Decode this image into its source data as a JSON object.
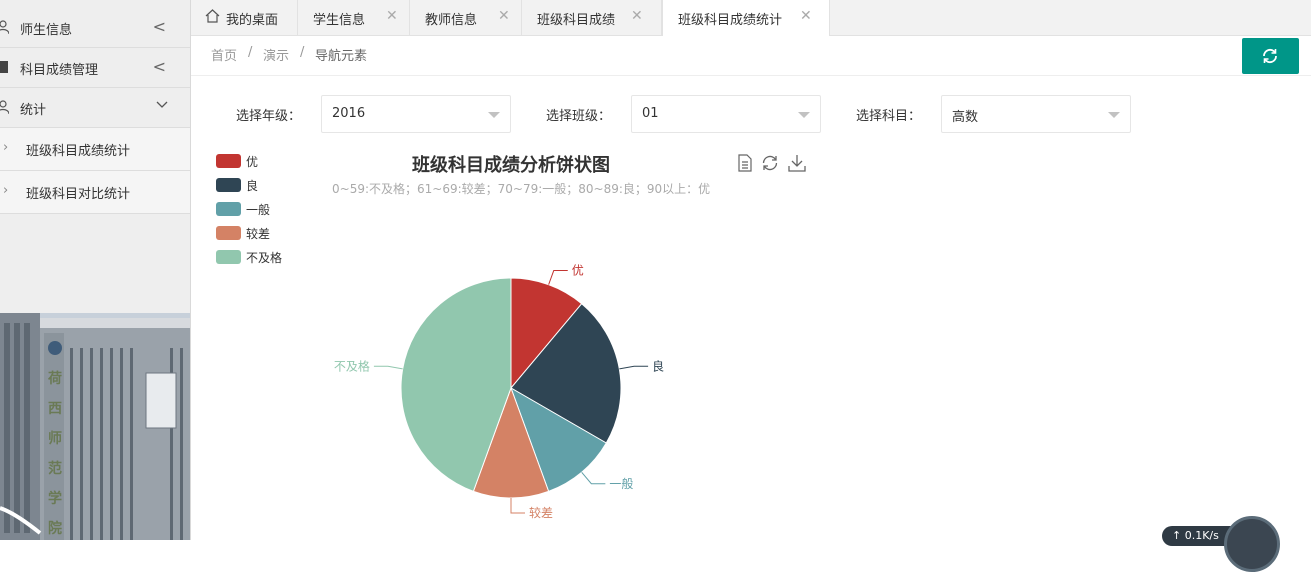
{
  "sidebar": {
    "items": [
      {
        "label": "师生信息",
        "arrow": "<"
      },
      {
        "label": "科目成绩管理",
        "arrow": "<"
      },
      {
        "label": "统计",
        "arrow": "v"
      }
    ],
    "subitems": [
      {
        "label": "班级科目成绩统计"
      },
      {
        "label": "班级科目对比统计"
      }
    ],
    "campus_sign": "荷 西 师 范 学 院"
  },
  "tabs": [
    {
      "label": "我的桌面",
      "icon": "home-icon"
    },
    {
      "label": "学生信息"
    },
    {
      "label": "教师信息"
    },
    {
      "label": "班级科目成绩"
    },
    {
      "label": "班级科目成绩统计",
      "active": true
    }
  ],
  "breadcrumb": [
    "首页",
    "/",
    "演示",
    "/",
    "导航元素"
  ],
  "filters": {
    "grade": {
      "label": "选择年级：",
      "value": "2016"
    },
    "class": {
      "label": "选择班级：",
      "value": "01"
    },
    "subject": {
      "label": "选择科目：",
      "value": "高数"
    }
  },
  "colors": {
    "accent": "#009688"
  },
  "chart_data": {
    "type": "pie",
    "title": "班级科目成绩分析饼状图",
    "subtitle": "0~59:不及格；61~69:较差；70~79:一般；80~89:良；90以上：优",
    "legend_position": "top-left",
    "slices": [
      {
        "name": "优",
        "value": 5,
        "color": "#c23531"
      },
      {
        "name": "良",
        "value": 10,
        "color": "#2f4554"
      },
      {
        "name": "一般",
        "value": 5,
        "color": "#61a0a8"
      },
      {
        "name": "较差",
        "value": 5,
        "color": "#d48265"
      },
      {
        "name": "不及格",
        "value": 20,
        "color": "#91c7ae"
      }
    ]
  },
  "speed_widget": {
    "text": "↑ 0.1K/s"
  }
}
